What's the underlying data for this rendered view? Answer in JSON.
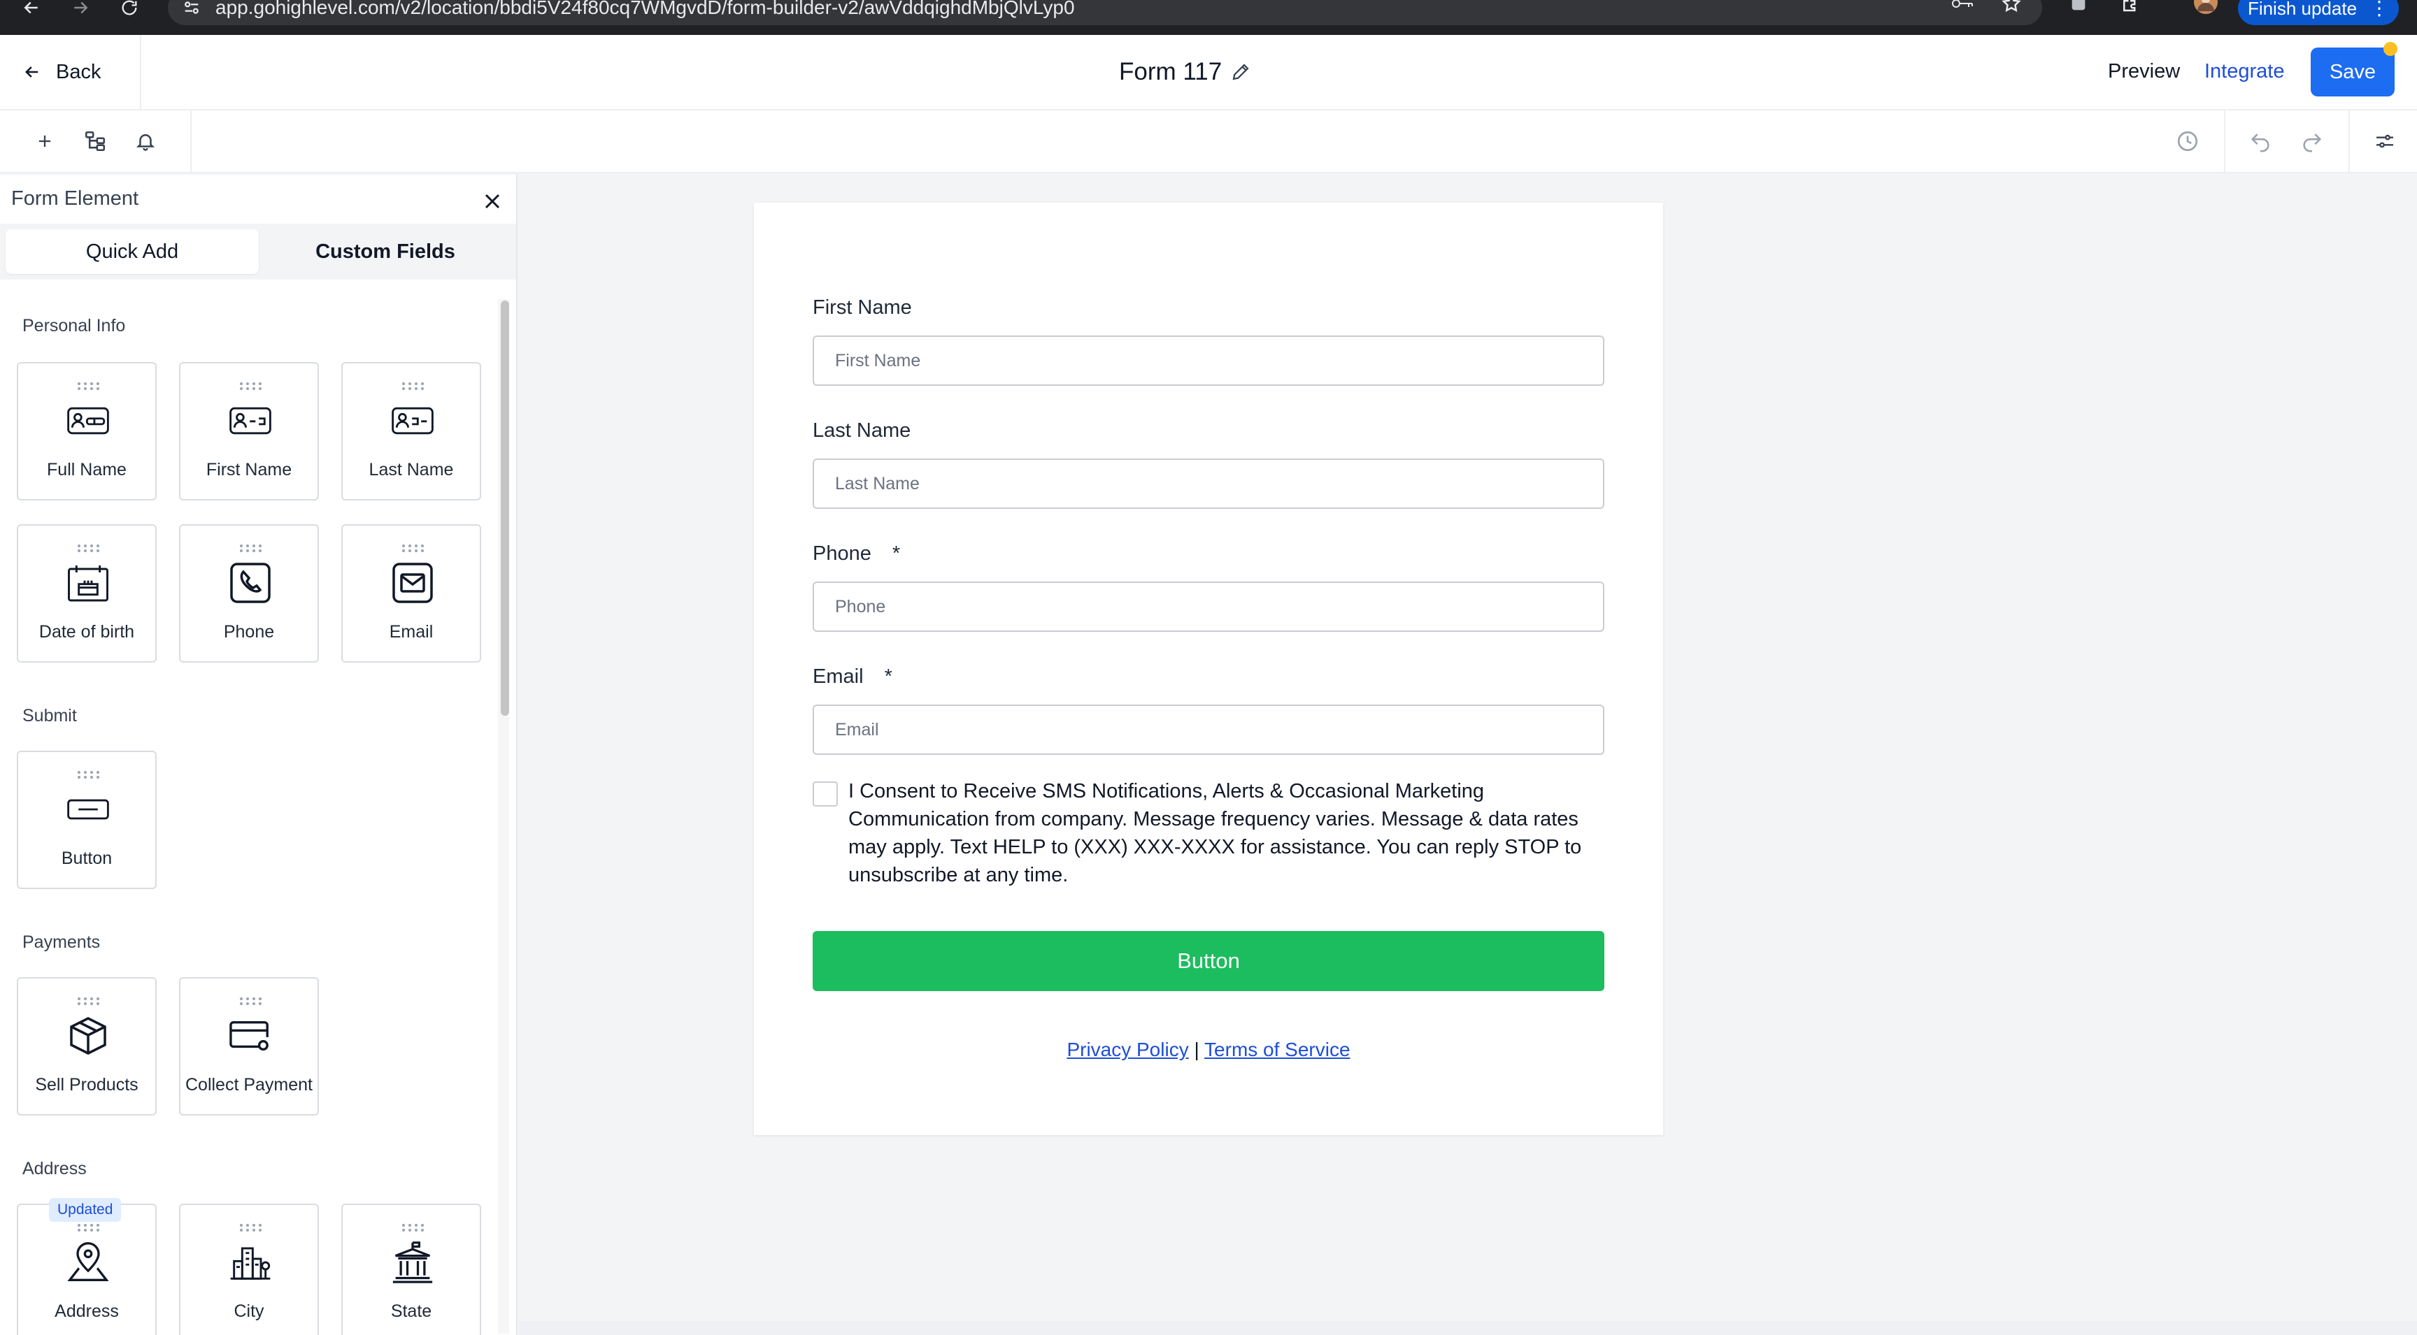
{
  "browser": {
    "url": "app.gohighlevel.com/v2/location/bbdi5V24f80cq7WMgvdD/form-builder-v2/awVddqighdMbjQlvLyp0",
    "finish_update_label": "Finish update"
  },
  "header": {
    "back_label": "Back",
    "form_title": "Form 117",
    "preview_label": "Preview",
    "integrate_label": "Integrate",
    "save_label": "Save"
  },
  "sidebar": {
    "title": "Form Element",
    "tabs": [
      {
        "label": "Quick Add"
      },
      {
        "label": "Custom Fields"
      }
    ],
    "sections": [
      {
        "label": "Personal Info",
        "items": [
          {
            "label": "Full Name",
            "icon": "full-name-icon"
          },
          {
            "label": "First Name",
            "icon": "first-name-icon"
          },
          {
            "label": "Last Name",
            "icon": "last-name-icon"
          },
          {
            "label": "Date of birth",
            "icon": "calendar-cake-icon"
          },
          {
            "label": "Phone",
            "icon": "phone-icon"
          },
          {
            "label": "Email",
            "icon": "email-icon"
          }
        ]
      },
      {
        "label": "Submit",
        "items": [
          {
            "label": "Button",
            "icon": "button-icon"
          }
        ]
      },
      {
        "label": "Payments",
        "items": [
          {
            "label": "Sell Products",
            "icon": "box-icon"
          },
          {
            "label": "Collect Payment",
            "icon": "card-icon"
          }
        ]
      },
      {
        "label": "Address",
        "items": [
          {
            "label": "Address",
            "icon": "map-pin-icon",
            "badge": "Updated"
          },
          {
            "label": "City",
            "icon": "city-icon"
          },
          {
            "label": "State",
            "icon": "state-building-icon"
          }
        ]
      }
    ]
  },
  "form": {
    "fields": [
      {
        "label": "First Name",
        "required": false,
        "placeholder": "First Name"
      },
      {
        "label": "Last Name",
        "required": false,
        "placeholder": "Last Name"
      },
      {
        "label": "Phone",
        "required": true,
        "placeholder": "Phone"
      },
      {
        "label": "Email",
        "required": true,
        "placeholder": "Email"
      }
    ],
    "required_marker": "*",
    "consent_text": "I Consent to Receive SMS Notifications, Alerts & Occasional Marketing Communication from company. Message frequency varies. Message & data rates may apply. Text HELP to (XXX) XXX-XXXX for assistance. You can reply STOP to unsubscribe at any time.",
    "button_label": "Button",
    "privacy_label": "Privacy Policy",
    "separator": "|",
    "terms_label": "Terms of Service"
  },
  "colors": {
    "primary": "#1d6df2",
    "submit": "#1cbd5e",
    "link": "#1d4ed8"
  }
}
